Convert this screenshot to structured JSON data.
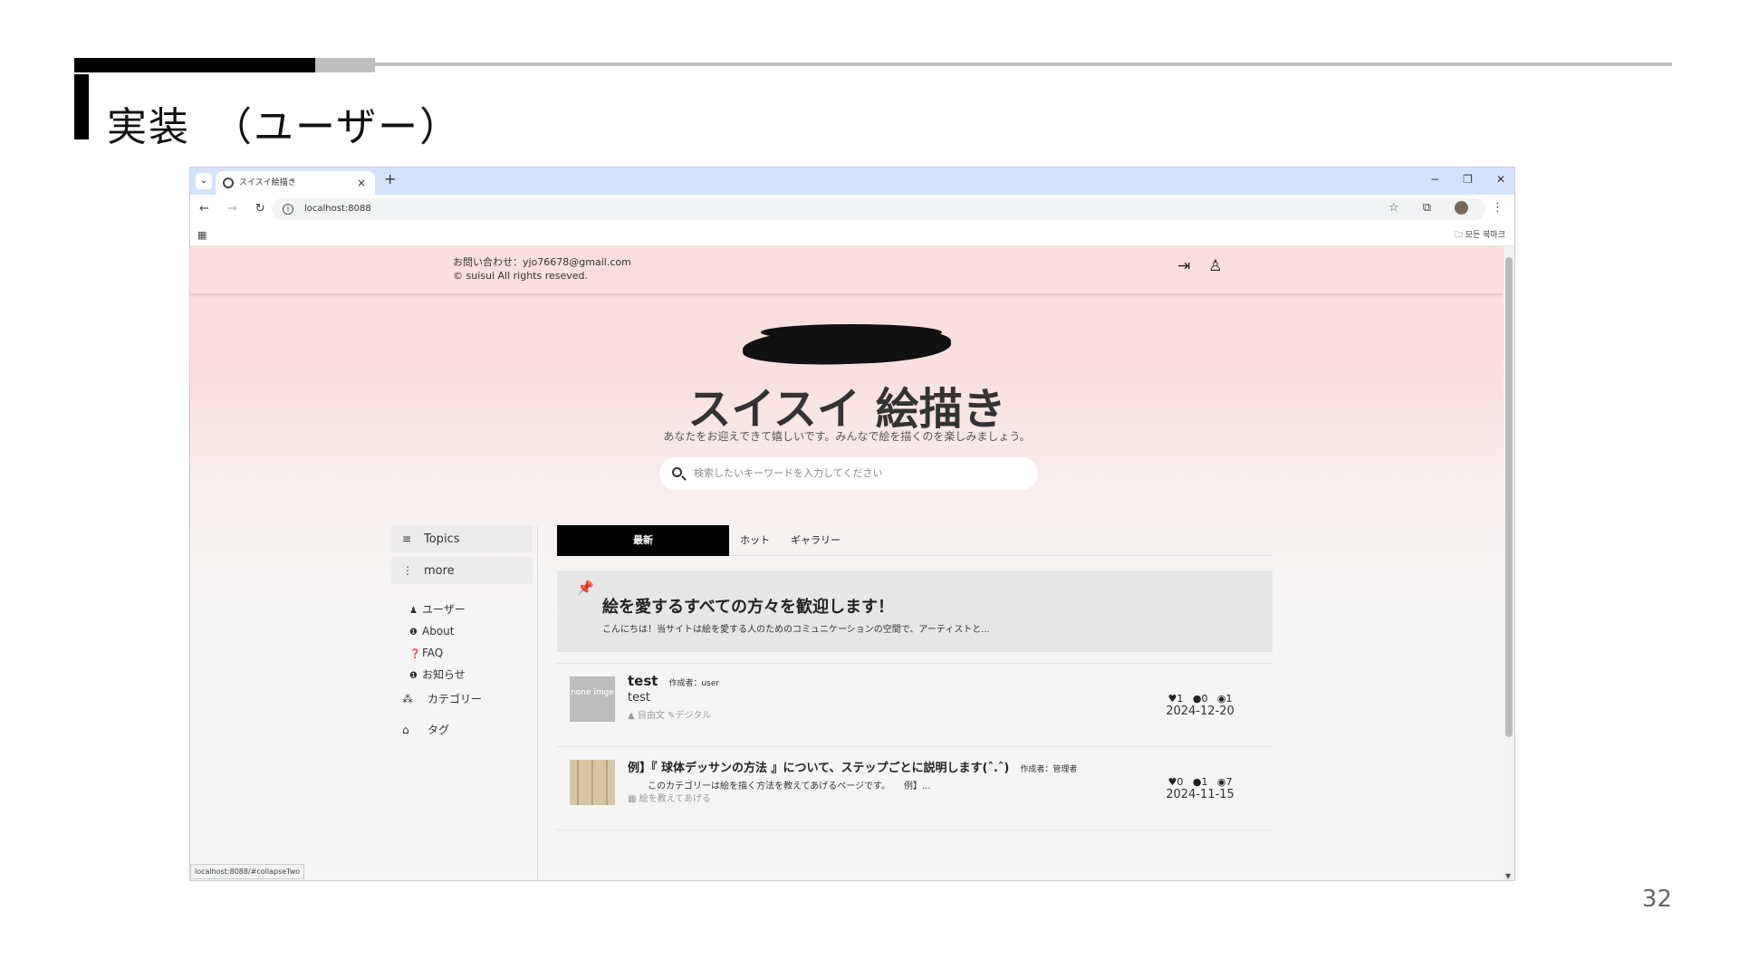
{
  "slide": {
    "title": "実装　（ユーザー）",
    "page_number": "32"
  },
  "browser": {
    "tab_title": "スイスイ絵描き",
    "tab_close": "×",
    "new_tab": "+",
    "url": "localhost:8088",
    "bookmarks_label": "모든 북마크",
    "status_url": "localhost:8088/#collapseTwo"
  },
  "site": {
    "contact_line1": "お問い合わせ：yjo76678@gmail.com",
    "contact_line2": "© suisui All rights reseved.",
    "title": "スイスイ 絵描き",
    "subtitle": "あなたをお迎えできて嬉しいです。みんなで絵を描くのを楽しみましょう。",
    "search_placeholder": "検索したいキーワードを入力してください"
  },
  "sidebar": {
    "topics_label": "Topics",
    "more_label": "more",
    "items": [
      {
        "icon": "user-icon",
        "label": "ユーザー"
      },
      {
        "icon": "info-icon",
        "label": "About"
      },
      {
        "icon": "question-icon",
        "label": "FAQ"
      },
      {
        "icon": "notice-icon",
        "label": "お知らせ"
      }
    ],
    "category_label": "カテゴリー",
    "tag_label": "タグ"
  },
  "main": {
    "tabs": [
      "最新",
      "ホット",
      "ギャラリー"
    ],
    "pinned": {
      "title": "絵を愛するすべての方々を歓迎します！",
      "text": "こんにちは！当サイトは絵を愛する人のためのコミュニケーションの空間で、アーティストと..."
    },
    "posts": [
      {
        "thumb_text": "none imge",
        "title": "test",
        "author": "作成者：user",
        "body": "test",
        "tags": "▲ 自由文 ✎デジタル",
        "likes": "1",
        "comments": "0",
        "views": "1",
        "date": "2024-12-20"
      },
      {
        "title": "例】『 球体デッサンの方法 』について、ステップごとに説明します(ˆ.ˆ)",
        "author": "作成者：管理者",
        "body": "このカテゴリーは絵を描く方法を教えてあげるページです。　　例】...",
        "tags": "▦ 絵を教えてあげる",
        "likes": "0",
        "comments": "1",
        "views": "7",
        "date": "2024-11-15"
      }
    ]
  }
}
